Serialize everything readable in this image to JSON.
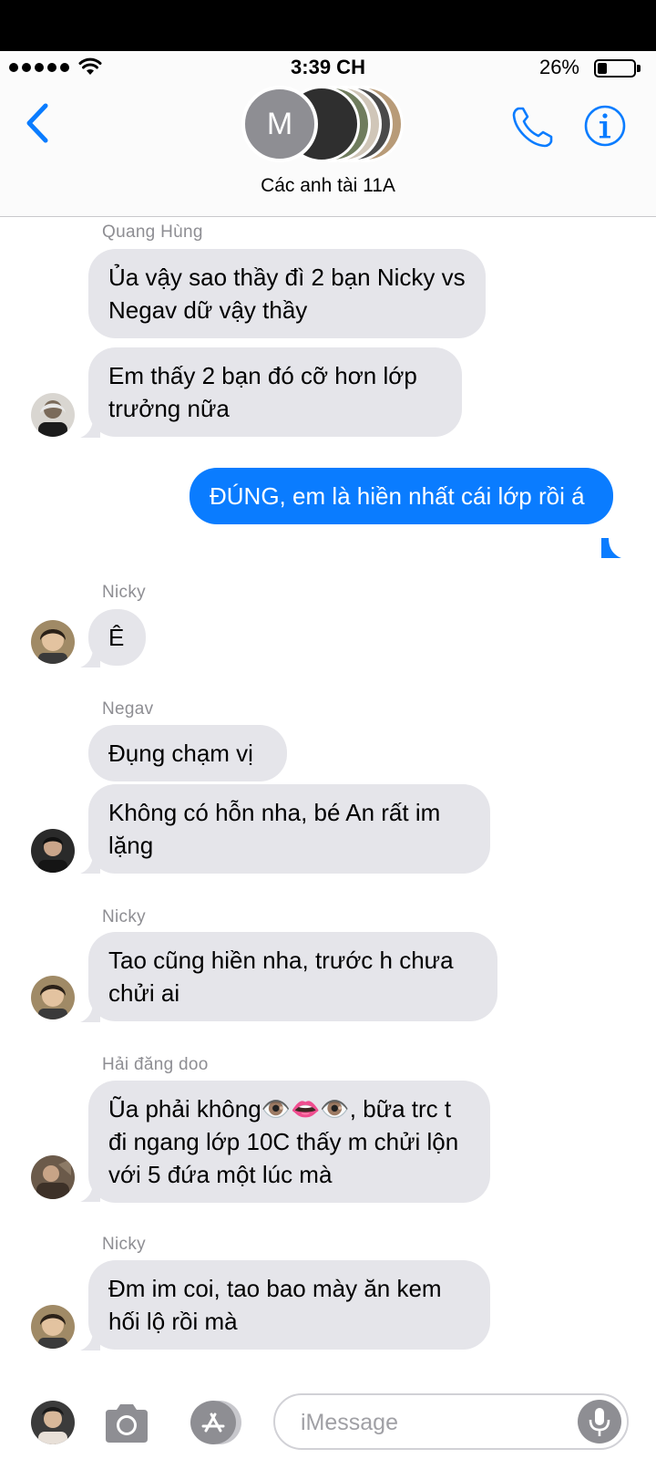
{
  "status_bar": {
    "time": "3:39 CH",
    "battery": "26%",
    "battery_level": 0.26
  },
  "header": {
    "group_avatar_initial": "M",
    "group_name": "Các anh tài 11A",
    "back_icon": "chevron-left-icon",
    "call_icon": "phone-icon",
    "info_icon": "info-icon",
    "accent_color": "#0a7cff"
  },
  "messages": [
    {
      "sender": "Quang Hùng",
      "text": "Ủa vậy sao thầy đì 2 bạn Nicky vs Negav dữ vậy thầy",
      "direction": "incoming"
    },
    {
      "text": "Em thấy 2 bạn đó cỡ hơn lớp trưởng nữa",
      "direction": "incoming"
    },
    {
      "text": "ĐÚNG, em là hiền nhất cái lớp rồi á",
      "direction": "outgoing"
    },
    {
      "sender": "Nicky",
      "text": "Ê",
      "direction": "incoming"
    },
    {
      "sender": "Negav",
      "text": "Đụng chạm vị",
      "direction": "incoming"
    },
    {
      "text": "Không có hỗn nha, bé An rất im lặng",
      "direction": "incoming"
    },
    {
      "sender": "Nicky",
      "text": "Tao cũng hiền nha, trước h chưa chửi ai",
      "direction": "incoming"
    },
    {
      "sender": "Hải đăng doo",
      "text": "Ũa phải không👁️👄👁️, bữa trc t đi ngang lớp 10C thấy m chửi lộn với 5 đứa một lúc mà",
      "direction": "incoming"
    },
    {
      "sender": "Nicky",
      "text": "Đm im coi, tao bao mày ăn kem hối lộ rồi mà",
      "direction": "incoming"
    }
  ],
  "composer": {
    "placeholder": "iMessage",
    "camera_icon": "camera-icon",
    "apps_icon": "app-store-icon",
    "mic_icon": "microphone-icon"
  }
}
